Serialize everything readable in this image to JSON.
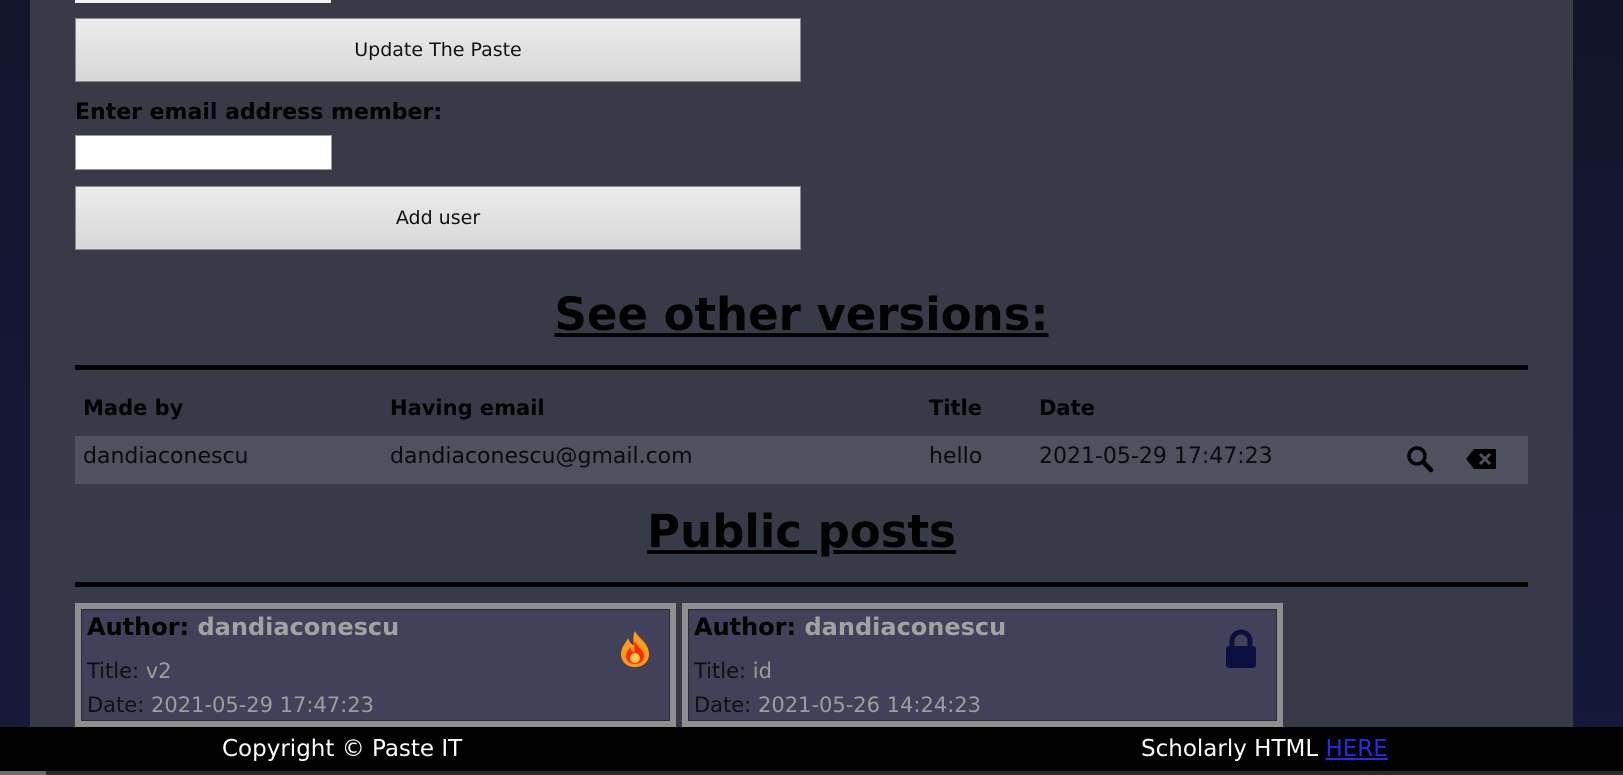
{
  "form": {
    "update_button_label": "Update The Paste",
    "email_label": "Enter email address member:",
    "email_value": "",
    "add_user_button_label": "Add user"
  },
  "versions": {
    "heading": "See other versions:",
    "columns": [
      "Made by",
      "Having email",
      "Title",
      "Date"
    ],
    "rows": [
      {
        "made_by": "dandiaconescu",
        "email": "dandiaconescu@gmail.com",
        "title": "hello",
        "date": "2021-05-29 17:47:23",
        "actions": [
          "search-icon",
          "backspace-delete-icon"
        ]
      }
    ]
  },
  "public_posts": {
    "heading": "Public posts",
    "author_label": "Author:",
    "title_label": "Title:",
    "date_label": "Date:",
    "cards": [
      {
        "author": "dandiaconescu",
        "title": "v2",
        "date": "2021-05-29 17:47:23",
        "icon": "fire-icon"
      },
      {
        "author": "dandiaconescu",
        "title": "id",
        "date": "2021-05-26 14:24:23",
        "icon": "lock-icon"
      }
    ]
  },
  "footer": {
    "copyright": "Copyright © Paste IT",
    "scholarly_prefix": "Scholarly HTML",
    "scholarly_link": "HERE"
  },
  "colors": {
    "panel": "#383a48",
    "card_bg": "#414159",
    "lock_icon": "#0b1040",
    "fire_outer": "#ff8c1a",
    "fire_inner": "#ff2a00"
  }
}
